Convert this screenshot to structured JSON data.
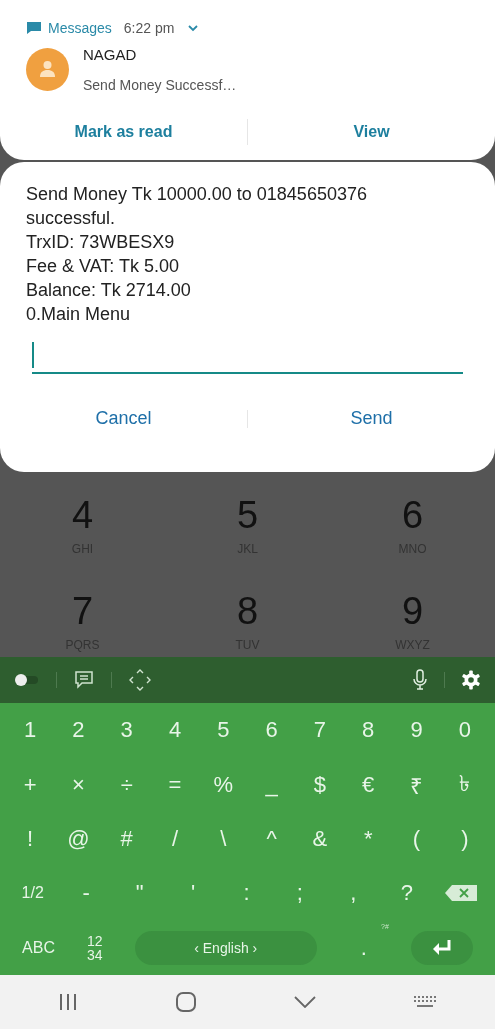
{
  "notification": {
    "app": "Messages",
    "time": "6:22 pm",
    "sender": "NAGAD",
    "preview": "Send Money Successf…",
    "actions": [
      "Mark as read",
      "View"
    ]
  },
  "dialog": {
    "message_lines": [
      "Send Money Tk 10000.00 to 01845650376 successful.",
      "TrxID: 73WBESX9",
      "Fee & VAT: Tk 5.00",
      "Balance: Tk 2714.00",
      "0.Main Menu"
    ],
    "buttons": [
      "Cancel",
      "Send"
    ]
  },
  "dialer": {
    "keys": [
      {
        "digit": "4",
        "letters": "GHI"
      },
      {
        "digit": "5",
        "letters": "JKL"
      },
      {
        "digit": "6",
        "letters": "MNO"
      },
      {
        "digit": "7",
        "letters": "PQRS"
      },
      {
        "digit": "8",
        "letters": "TUV"
      },
      {
        "digit": "9",
        "letters": "WXYZ"
      }
    ]
  },
  "keyboard": {
    "toolbar": {
      "toggle": {
        "on": false
      }
    },
    "rows": [
      [
        {
          "kind": "char",
          "label": "1"
        },
        {
          "kind": "char",
          "label": "2"
        },
        {
          "kind": "char",
          "label": "3"
        },
        {
          "kind": "char",
          "label": "4"
        },
        {
          "kind": "char",
          "label": "5"
        },
        {
          "kind": "char",
          "label": "6"
        },
        {
          "kind": "char",
          "label": "7"
        },
        {
          "kind": "char",
          "label": "8"
        },
        {
          "kind": "char",
          "label": "9"
        },
        {
          "kind": "char",
          "label": "0"
        }
      ],
      [
        {
          "kind": "char",
          "label": "+"
        },
        {
          "kind": "char",
          "label": "×"
        },
        {
          "kind": "char",
          "label": "÷"
        },
        {
          "kind": "char",
          "label": "="
        },
        {
          "kind": "char",
          "label": "%"
        },
        {
          "kind": "char",
          "label": "_"
        },
        {
          "kind": "char",
          "label": "$"
        },
        {
          "kind": "char",
          "label": "€"
        },
        {
          "kind": "char",
          "label": "₹"
        },
        {
          "kind": "char",
          "label": "৳"
        }
      ],
      [
        {
          "kind": "char",
          "label": "!"
        },
        {
          "kind": "char",
          "label": "@"
        },
        {
          "kind": "char",
          "label": "#"
        },
        {
          "kind": "char",
          "label": "/"
        },
        {
          "kind": "char",
          "label": "\\"
        },
        {
          "kind": "char",
          "label": "^"
        },
        {
          "kind": "char",
          "label": "&"
        },
        {
          "kind": "char",
          "label": "*"
        },
        {
          "kind": "char",
          "label": "("
        },
        {
          "kind": "char",
          "label": ")"
        }
      ],
      [
        {
          "kind": "char",
          "label": "1/2"
        },
        {
          "kind": "char",
          "label": "-"
        },
        {
          "kind": "char",
          "label": "\""
        },
        {
          "kind": "char",
          "label": "'"
        },
        {
          "kind": "char",
          "label": ":"
        },
        {
          "kind": "char",
          "label": ";"
        },
        {
          "kind": "char",
          "label": ","
        },
        {
          "kind": "char",
          "label": "?"
        },
        {
          "kind": "backspace"
        }
      ]
    ],
    "bottom_bar": [
      {
        "kind": "mode",
        "label": "ABC"
      },
      {
        "kind": "numpad",
        "lines": [
          "12",
          "34"
        ]
      },
      {
        "kind": "space",
        "label": "‹ English ›"
      },
      {
        "kind": "period",
        "label": ".",
        "hint": "?#"
      },
      {
        "kind": "enter"
      }
    ]
  }
}
